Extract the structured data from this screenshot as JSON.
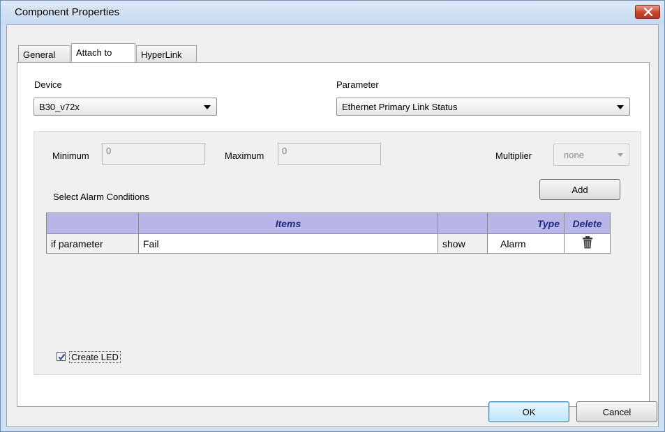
{
  "window": {
    "title": "Component Properties",
    "close_icon": "close-icon"
  },
  "tabs": [
    {
      "label": "General",
      "active": false
    },
    {
      "label": "Attach to",
      "active": true
    },
    {
      "label": "HyperLink",
      "active": false
    }
  ],
  "device": {
    "label": "Device",
    "value": "B30_v72x"
  },
  "parameter": {
    "label": "Parameter",
    "value": "Ethernet Primary Link Status"
  },
  "minimum": {
    "label": "Minimum",
    "value": "0"
  },
  "maximum": {
    "label": "Maximum",
    "value": "0"
  },
  "multiplier": {
    "label": "Multiplier",
    "value": "none"
  },
  "alarm": {
    "section_label": "Select Alarm Conditions",
    "add_label": "Add",
    "columns": [
      "",
      "Items",
      "",
      "Type",
      "Delete"
    ],
    "rows": [
      {
        "condition": "if parameter",
        "item": "Fail",
        "action": "show",
        "type": "Alarm",
        "delete_icon": "trash-icon"
      }
    ]
  },
  "create_led": {
    "label": "Create LED",
    "checked": true
  },
  "footer": {
    "ok_label": "OK",
    "cancel_label": "Cancel"
  }
}
